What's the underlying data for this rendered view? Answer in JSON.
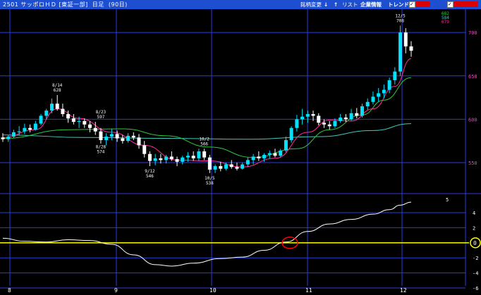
{
  "header": {
    "title": "2501 サッポロＨＤ [東証一部]  日足  (90日)",
    "btn_change": "銘柄変更",
    "btn_down": "↓",
    "btn_up": "↑",
    "btn_list": "リスト",
    "btn_company": "企業情報",
    "btn_trend": "トレンド"
  },
  "legend": [
    "682",
    "584",
    "679"
  ],
  "price_axis": {
    "ticks": [
      "700",
      "650",
      "600",
      "550"
    ],
    "range": [
      520,
      705
    ]
  },
  "indicator_axis": {
    "ticks": [
      "4",
      "2",
      "0",
      "-2",
      "-4",
      "-6"
    ],
    "current_marker": "5",
    "zero_label": "0"
  },
  "x_axis": {
    "months": [
      "8",
      "9",
      "10",
      "11",
      "12"
    ]
  },
  "annotations": [
    {
      "date": "8/14",
      "value": "628"
    },
    {
      "date": "8/23",
      "value": "597"
    },
    {
      "date": "8/28",
      "value": "574"
    },
    {
      "date": "9/12",
      "value": "546"
    },
    {
      "date": "10/2",
      "value": "566"
    },
    {
      "date": "10/5",
      "value": "538"
    },
    {
      "date": "12/5",
      "value": "708"
    }
  ],
  "colors": {
    "background": "#000000",
    "header": "#1e4fd0",
    "grid": "#2a3de0",
    "up_candle": "#00e0ff",
    "down_candle": "#ffffff",
    "ma_short": "#ff2f9a",
    "ma_mid": "#2ec83a",
    "ma_long": "#3fc9c0",
    "oscillator": "#ffffff",
    "zero_line": "#ffff00",
    "highlight_circle": "#ff0000"
  },
  "chart_data": {
    "type": "line",
    "title": "2501 サッポロＨＤ [東証一部] 日足 (90日)",
    "candles": [
      [
        579,
        584,
        574,
        577
      ],
      [
        577,
        582,
        574,
        580
      ],
      [
        580,
        588,
        578,
        585
      ],
      [
        585,
        592,
        582,
        586
      ],
      [
        586,
        595,
        583,
        590
      ],
      [
        590,
        594,
        585,
        588
      ],
      [
        588,
        598,
        587,
        595
      ],
      [
        595,
        606,
        593,
        604
      ],
      [
        604,
        612,
        600,
        610
      ],
      [
        610,
        624,
        607,
        618
      ],
      [
        618,
        628,
        610,
        612
      ],
      [
        612,
        618,
        603,
        606
      ],
      [
        606,
        610,
        596,
        601
      ],
      [
        601,
        606,
        594,
        597
      ],
      [
        597,
        603,
        590,
        598
      ],
      [
        598,
        601,
        590,
        594
      ],
      [
        594,
        598,
        585,
        590
      ],
      [
        590,
        597,
        582,
        586
      ],
      [
        586,
        590,
        572,
        576
      ],
      [
        576,
        584,
        570,
        580
      ],
      [
        580,
        589,
        576,
        583
      ],
      [
        583,
        587,
        574,
        578
      ],
      [
        578,
        582,
        572,
        575
      ],
      [
        575,
        584,
        573,
        581
      ],
      [
        581,
        585,
        576,
        579
      ],
      [
        579,
        583,
        566,
        570
      ],
      [
        570,
        575,
        556,
        560
      ],
      [
        560,
        563,
        546,
        552
      ],
      [
        552,
        560,
        547,
        555
      ],
      [
        555,
        560,
        549,
        553
      ],
      [
        553,
        559,
        549,
        557
      ],
      [
        557,
        563,
        552,
        554
      ],
      [
        554,
        557,
        546,
        551
      ],
      [
        551,
        558,
        548,
        556
      ],
      [
        556,
        562,
        551,
        558
      ],
      [
        558,
        563,
        552,
        555
      ],
      [
        555,
        566,
        552,
        563
      ],
      [
        563,
        566,
        553,
        556
      ],
      [
        556,
        559,
        538,
        542
      ],
      [
        542,
        548,
        538,
        546
      ],
      [
        546,
        551,
        540,
        543
      ],
      [
        543,
        550,
        541,
        548
      ],
      [
        548,
        553,
        543,
        545
      ],
      [
        545,
        550,
        541,
        543
      ],
      [
        543,
        550,
        542,
        548
      ],
      [
        548,
        556,
        545,
        553
      ],
      [
        553,
        560,
        548,
        557
      ],
      [
        557,
        563,
        552,
        555
      ],
      [
        555,
        561,
        551,
        559
      ],
      [
        559,
        564,
        555,
        561
      ],
      [
        561,
        566,
        556,
        558
      ],
      [
        558,
        566,
        556,
        564
      ],
      [
        564,
        580,
        562,
        576
      ],
      [
        576,
        592,
        573,
        590
      ],
      [
        590,
        605,
        586,
        600
      ],
      [
        600,
        612,
        594,
        603
      ],
      [
        603,
        610,
        596,
        606
      ],
      [
        606,
        610,
        598,
        604
      ],
      [
        604,
        607,
        593,
        596
      ],
      [
        596,
        600,
        590,
        594
      ],
      [
        594,
        598,
        588,
        592
      ],
      [
        592,
        601,
        590,
        598
      ],
      [
        598,
        606,
        596,
        602
      ],
      [
        602,
        606,
        597,
        600
      ],
      [
        600,
        612,
        598,
        607
      ],
      [
        607,
        613,
        601,
        604
      ],
      [
        604,
        618,
        602,
        615
      ],
      [
        615,
        624,
        611,
        620
      ],
      [
        620,
        632,
        617,
        626
      ],
      [
        626,
        636,
        620,
        630
      ],
      [
        630,
        640,
        624,
        634
      ],
      [
        634,
        648,
        630,
        645
      ],
      [
        645,
        660,
        640,
        655
      ],
      [
        655,
        708,
        650,
        700
      ],
      [
        700,
        705,
        676,
        684
      ],
      [
        684,
        690,
        672,
        679
      ]
    ],
    "ma_short": [
      [
        0,
        579
      ],
      [
        6,
        588
      ],
      [
        10,
        612
      ],
      [
        14,
        601
      ],
      [
        20,
        585
      ],
      [
        26,
        570
      ],
      [
        32,
        553
      ],
      [
        38,
        552
      ],
      [
        44,
        545
      ],
      [
        50,
        555
      ],
      [
        56,
        585
      ],
      [
        60,
        599
      ],
      [
        64,
        598
      ],
      [
        68,
        612
      ],
      [
        72,
        638
      ],
      [
        75,
        670
      ]
    ],
    "ma_mid": [
      [
        0,
        578
      ],
      [
        12,
        588
      ],
      [
        22,
        589
      ],
      [
        30,
        581
      ],
      [
        38,
        568
      ],
      [
        46,
        556
      ],
      [
        54,
        566
      ],
      [
        60,
        588
      ],
      [
        66,
        605
      ],
      [
        70,
        622
      ],
      [
        75,
        648
      ]
    ],
    "ma_long": [
      [
        0,
        582
      ],
      [
        15,
        579
      ],
      [
        30,
        578
      ],
      [
        45,
        577
      ],
      [
        58,
        580
      ],
      [
        68,
        587
      ],
      [
        75,
        595
      ]
    ],
    "oscillator": [
      [
        0,
        0.6
      ],
      [
        4,
        0.2
      ],
      [
        8,
        0.1
      ],
      [
        12,
        0.4
      ],
      [
        16,
        0.3
      ],
      [
        20,
        -0.2
      ],
      [
        24,
        -1.6
      ],
      [
        28,
        -2.9
      ],
      [
        31,
        -3.1
      ],
      [
        35,
        -2.7
      ],
      [
        40,
        -2.1
      ],
      [
        44,
        -1.9
      ],
      [
        48,
        -1.0
      ],
      [
        52,
        0.1
      ],
      [
        56,
        1.5
      ],
      [
        60,
        2.5
      ],
      [
        64,
        3.1
      ],
      [
        68,
        3.8
      ],
      [
        71,
        4.4
      ],
      [
        73,
        5.0
      ],
      [
        75,
        5.4
      ]
    ],
    "ylim": [
      520,
      705
    ],
    "osc_ylim": [
      -6,
      5.5
    ]
  }
}
